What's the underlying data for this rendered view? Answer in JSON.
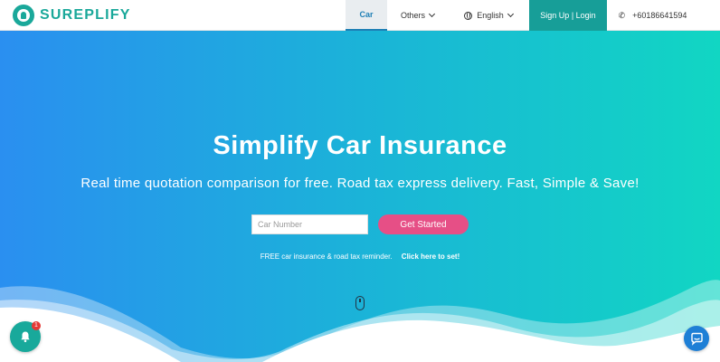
{
  "brand": {
    "name": "SUREPLIFY",
    "color": "#1aa89a"
  },
  "nav": {
    "car": "Car",
    "others": "Others",
    "language": "English",
    "signup": "Sign Up | Login",
    "phone": "+60186641594"
  },
  "hero": {
    "title": "Simplify Car Insurance",
    "subtitle": "Real time quotation comparison for free. Road tax express delivery. Fast, Simple & Save!",
    "input_placeholder": "Car Number",
    "cta": "Get Started",
    "reminder_text": "FREE car insurance & road tax reminder.",
    "reminder_link": "Click here to set!"
  },
  "notifications": {
    "count": "1"
  },
  "icons": {
    "brand": "brand-logo-icon",
    "others_chevron": "chevron-down-icon",
    "language": "globe-icon",
    "phone": "phone-icon",
    "scroll": "mouse-scroll-icon",
    "bell": "bell-icon",
    "chat": "chat-icon"
  },
  "colors": {
    "gradient_start": "#2a8ff0",
    "gradient_end": "#11d6c3",
    "cta": "#e64f86",
    "signup_bg": "#179e98",
    "active_tab": "#1e7fb5"
  }
}
